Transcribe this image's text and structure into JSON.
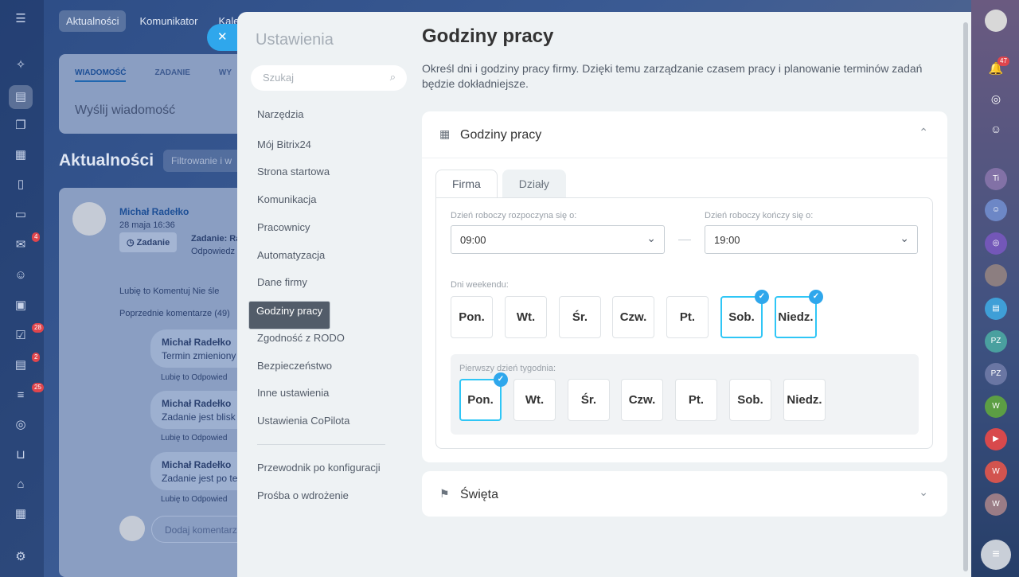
{
  "background": {
    "top_tabs": [
      "Aktualności",
      "Komunikator",
      "Kale"
    ],
    "message_tabs": [
      "WIADOMOŚĆ",
      "ZADANIE",
      "WY"
    ],
    "message_placeholder": "Wyślij wiadomość",
    "feed_title": "Aktualności",
    "filter_placeholder": "Filtrowanie i w",
    "post": {
      "author": "Michał Radełko",
      "date": "28 maja 16:36",
      "badge": "Zadanie",
      "task_title": "Zadanie: Ra",
      "task_sub": "Odpowiedz",
      "actions": "Lubię to   Komentuj   Nie śle",
      "prev_comments": "Poprzednie komentarze (49)",
      "comments": [
        {
          "author": "Michał Radełko",
          "text": "Termin zmieniony",
          "actions": "Lubię to   Odpowied"
        },
        {
          "author": "Michał Radełko",
          "text": "Zadanie jest blisk",
          "actions": "Lubię to   Odpowied"
        },
        {
          "author": "Michał Radełko",
          "text": "Zadanie jest po te",
          "actions": "Lubię to   Odpowied"
        }
      ],
      "add_comment": "Dodaj komentarz"
    },
    "left_counters": [
      "4",
      "28",
      "2",
      "25"
    ],
    "right_counter": "47",
    "right_chats": [
      "Ti",
      "PZ",
      "PZ",
      "W",
      "W",
      "W"
    ]
  },
  "close_icon": "close-icon",
  "menu": {
    "title": "Ustawienia",
    "search_placeholder": "Szukaj",
    "items": [
      "Narzędzia",
      "Mój Bitrix24",
      "Strona startowa",
      "Komunikacja",
      "Pracownicy",
      "Automatyzacja",
      "Dane firmy",
      "Godziny pracy",
      "Zgodność z RODO",
      "Bezpieczeństwo",
      "Inne ustawienia",
      "Ustawienia CoPilota"
    ],
    "selected": "Godziny pracy",
    "extra_items": [
      "Przewodnik po konfiguracji",
      "Prośba o wdrożenie"
    ]
  },
  "page": {
    "title": "Godziny pracy",
    "description": "Określ dni i godziny pracy firmy. Dzięki temu zarządzanie czasem pracy i planowanie terminów zadań będzie dokładniejsze."
  },
  "work_hours_card": {
    "title": "Godziny pracy",
    "tabs": [
      "Firma",
      "Działy"
    ],
    "active_tab": "Firma",
    "start_label": "Dzień roboczy rozpoczyna się o:",
    "start_value": "09:00",
    "end_label": "Dzień roboczy kończy się o:",
    "end_value": "19:00",
    "weekend_label": "Dni weekendu:",
    "weekend_days": [
      "Pon.",
      "Wt.",
      "Śr.",
      "Czw.",
      "Pt.",
      "Sob.",
      "Niedz."
    ],
    "weekend_selected": [
      "Sob.",
      "Niedz."
    ],
    "first_day_label": "Pierwszy dzień tygodnia:",
    "first_days": [
      "Pon.",
      "Wt.",
      "Śr.",
      "Czw.",
      "Pt.",
      "Sob.",
      "Niedz."
    ],
    "first_day_selected": "Pon."
  },
  "holidays_card": {
    "title": "Święta"
  },
  "colors": {
    "accent": "#2fa7ec",
    "selected_border": "#2fc6f6",
    "menu_selected_bg": "#525c69"
  }
}
